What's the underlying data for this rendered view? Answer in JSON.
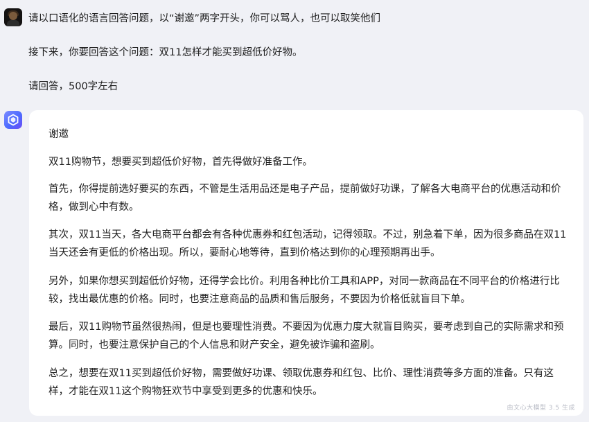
{
  "user_message": {
    "lines": [
      "请以口语化的语言回答问题，以“谢邀”两字开头，你可以骂人，也可以取笑他们",
      "接下来，你要回答这个问题：双11怎样才能买到超低价好物。",
      "请回答，500字左右"
    ]
  },
  "bot_answer": {
    "paragraphs": [
      "谢邀",
      "双11购物节，想要买到超低价好物，首先得做好准备工作。",
      "首先，你得提前选好要买的东西，不管是生活用品还是电子产品，提前做好功课，了解各大电商平台的优惠活动和价格，做到心中有数。",
      "其次，双11当天，各大电商平台都会有各种优惠券和红包活动，记得领取。不过，别急着下单，因为很多商品在双11当天还会有更低的价格出现。所以，要耐心地等待，直到价格达到你的心理预期再出手。",
      "另外，如果你想买到超低价好物，还得学会比价。利用各种比价工具和APP，对同一款商品在不同平台的价格进行比较，找出最优惠的价格。同时，也要注意商品的品质和售后服务，不要因为价格低就盲目下单。",
      "最后，双11购物节虽然很热闹，但是也要理性消费。不要因为优惠力度大就盲目购买，要考虑到自己的实际需求和预算。同时，也要注意保护自己的个人信息和财产安全，避免被诈骗和盗刷。",
      "总之，想要在双11买到超低价好物，需要做好功课、领取优惠券和红包、比价、理性消费等多方面的准备。只有这样，才能在双11这个购物狂欢节中享受到更多的优惠和快乐。"
    ],
    "footer_note": "由文心大模型 3.5 生成"
  },
  "icons": {
    "user_avatar": "user-avatar-photo",
    "bot_avatar": "ernie-bot-cube-icon"
  },
  "colors": {
    "page_background": "#f0f1f6",
    "card_background": "#ffffff",
    "bot_avatar_accent": "#4d6bff"
  }
}
